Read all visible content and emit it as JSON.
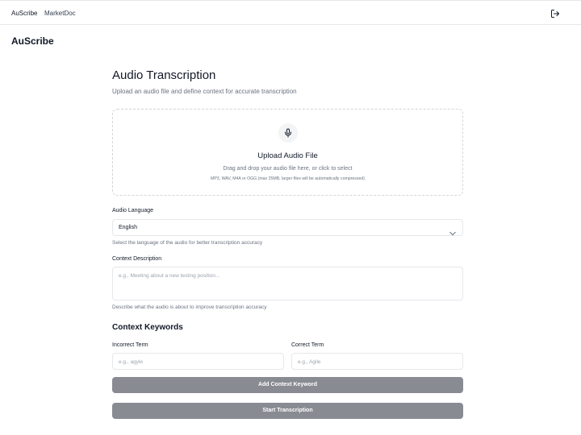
{
  "nav": {
    "items": [
      {
        "label": "AuScribe"
      },
      {
        "label": "MarketDoc"
      }
    ],
    "logout_icon": "logout-icon"
  },
  "brand": "AuScribe",
  "page": {
    "title": "Audio Transcription",
    "subtitle": "Upload an audio file and define context for accurate transcription"
  },
  "upload": {
    "icon": "microphone-icon",
    "title": "Upload Audio File",
    "hint": "Drag and drop your audio file here, or click to select",
    "formats": "MP3, WAV, M4A or OGG (max 25MB, larger files will be automatically compressed)"
  },
  "language": {
    "label": "Audio Language",
    "value": "English",
    "help": "Select the language of the audio for better transcription accuracy"
  },
  "context": {
    "label": "Context Description",
    "placeholder": "e.g., Meeting about a new testing position...",
    "help": "Describe what the audio is about to improve transcription accuracy"
  },
  "keywords": {
    "title": "Context Keywords",
    "incorrect_label": "Incorrect Term",
    "incorrect_placeholder": "e.g., agyle",
    "correct_label": "Correct Term",
    "correct_placeholder": "e.g., Agile",
    "add_button": "Add Context Keyword"
  },
  "submit_button": "Start Transcription",
  "colors": {
    "button_bg": "#898b93",
    "border": "#e5e7eb",
    "muted_text": "#6b7280"
  }
}
